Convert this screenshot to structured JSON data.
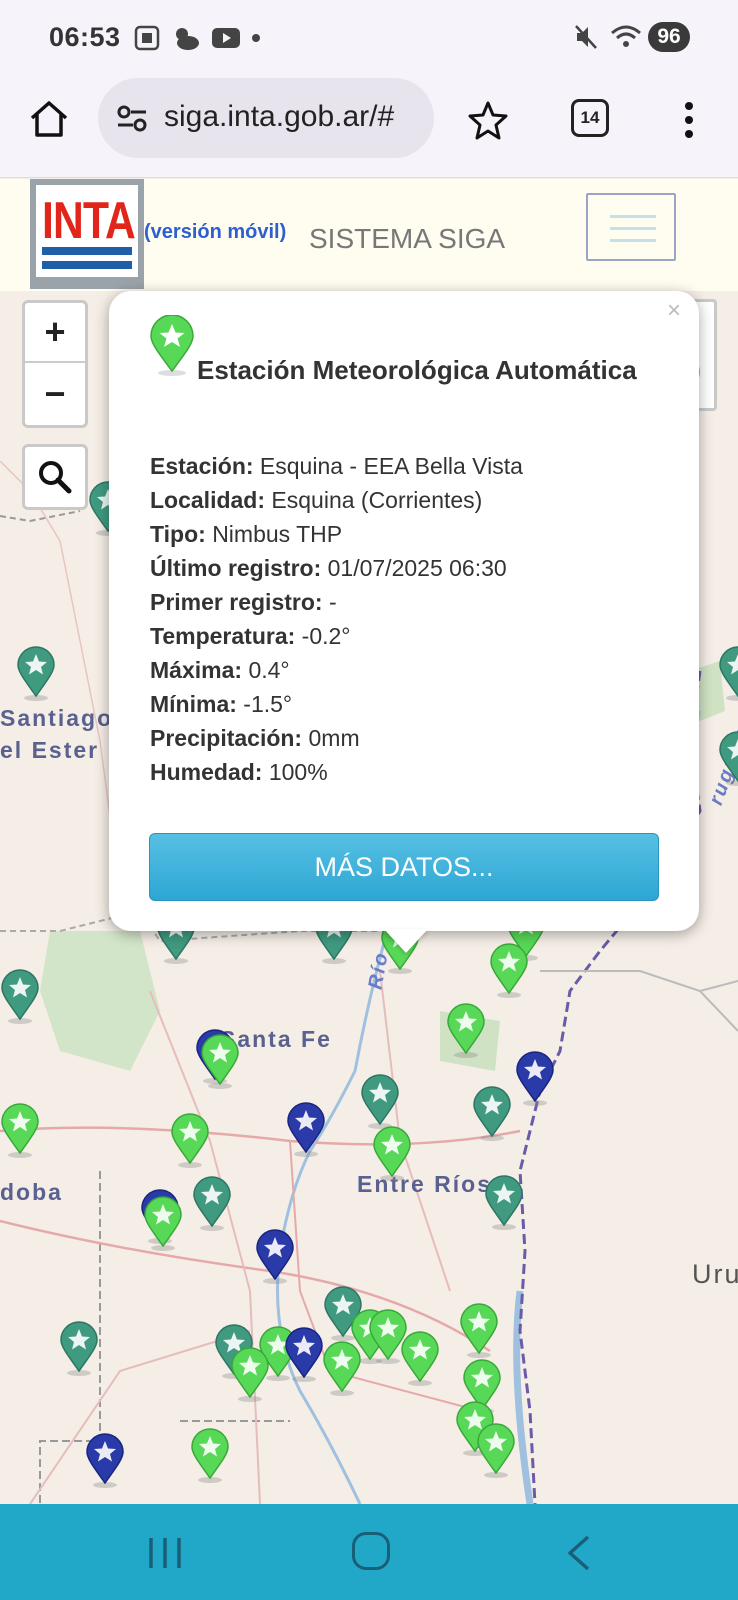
{
  "status_bar": {
    "time": "06:53",
    "battery": "96"
  },
  "browser": {
    "url": "siga.inta.gob.ar/#",
    "tab_count": "14"
  },
  "header": {
    "logo_text": "INTA",
    "version_label": "(versión móvil)",
    "system_title": "SISTEMA SIGA"
  },
  "map": {
    "zoom_in_label": "+",
    "zoom_out_label": "−",
    "labels": {
      "santiago": "Santiago",
      "estero": "el Ester",
      "santa_fe": "Santa Fe",
      "entre_rios": "Entre Ríos",
      "cordoba": "doba",
      "uruguay": "Uru",
      "rio": "Río",
      "rio_uruguay": "ruguay",
      "rio_r": "R"
    }
  },
  "popup": {
    "close_label": "×",
    "title": "Estación Meteorológica Automática",
    "fields": [
      {
        "label": "Estación:",
        "value": "Esquina - EEA Bella Vista"
      },
      {
        "label": "Localidad:",
        "value": "Esquina (Corrientes)"
      },
      {
        "label": "Tipo:",
        "value": "Nimbus THP"
      },
      {
        "label": "Último registro:",
        "value": "01/07/2025 06:30"
      },
      {
        "label": "Primer registro:",
        "value": "-"
      },
      {
        "label": "Temperatura:",
        "value": "-0.2°"
      },
      {
        "label": "Máxima:",
        "value": "0.4°"
      },
      {
        "label": "Mínima:",
        "value": "-1.5°"
      },
      {
        "label": "Precipitación:",
        "value": "0mm"
      },
      {
        "label": "Humedad:",
        "value": "100%"
      }
    ],
    "more_button": "MÁS DATOS..."
  },
  "colors": {
    "marker_green": "#57d957",
    "marker_teal": "#3f9a80",
    "marker_blue": "#2a3aa8",
    "button_blue": "#3ab4df",
    "navbar": "#21a8c8"
  }
}
